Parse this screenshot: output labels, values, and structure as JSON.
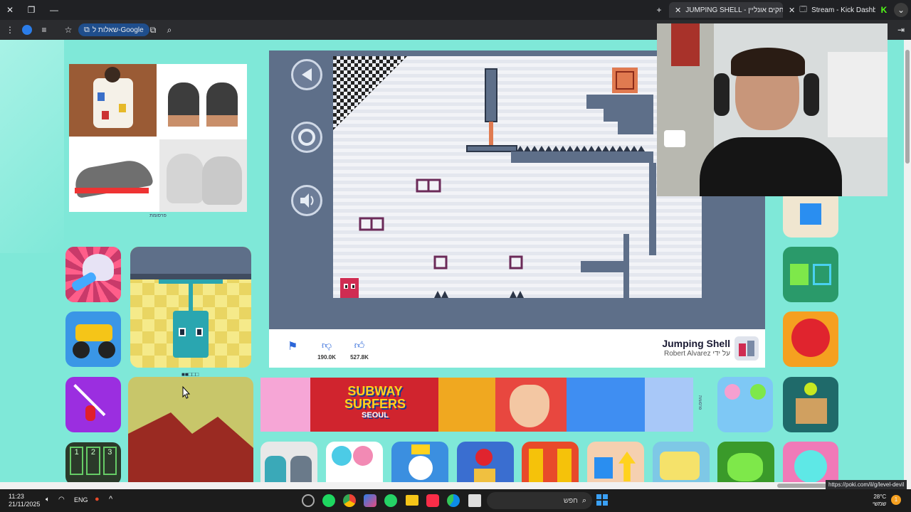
{
  "browser": {
    "tabs": [
      {
        "label": "JUMPING SHELL - משחקים אונליין",
        "active": true
      },
      {
        "label": "Stream - Kick Dashboard",
        "active": false
      }
    ],
    "address_chip": "שאלות ל-Google",
    "status_url": "https://poki.com/il/g/level-devil"
  },
  "ad": {
    "label": "פרסומת"
  },
  "game": {
    "title": "Jumping Shell",
    "author": "Robert Alvarez על ידי",
    "dislikes": "190.0K",
    "likes": "527.8K"
  },
  "banner": {
    "title_line1": "SUBWAY",
    "title_line2": "SURFERS",
    "subtitle": "SEOUL",
    "ad_label": "פרסומת"
  },
  "pagination": "■■□□□",
  "taskbar": {
    "time": "11:23",
    "date": "21/11/2025",
    "lang": "ENG",
    "search_placeholder": "חפש",
    "weather_temp": "28°C",
    "weather_label": "שמשי",
    "notif_count": "1"
  },
  "colors": {
    "page_bg": "#7fe8d8",
    "game_bg": "#5e6f89",
    "accent": "#2b66d9"
  }
}
